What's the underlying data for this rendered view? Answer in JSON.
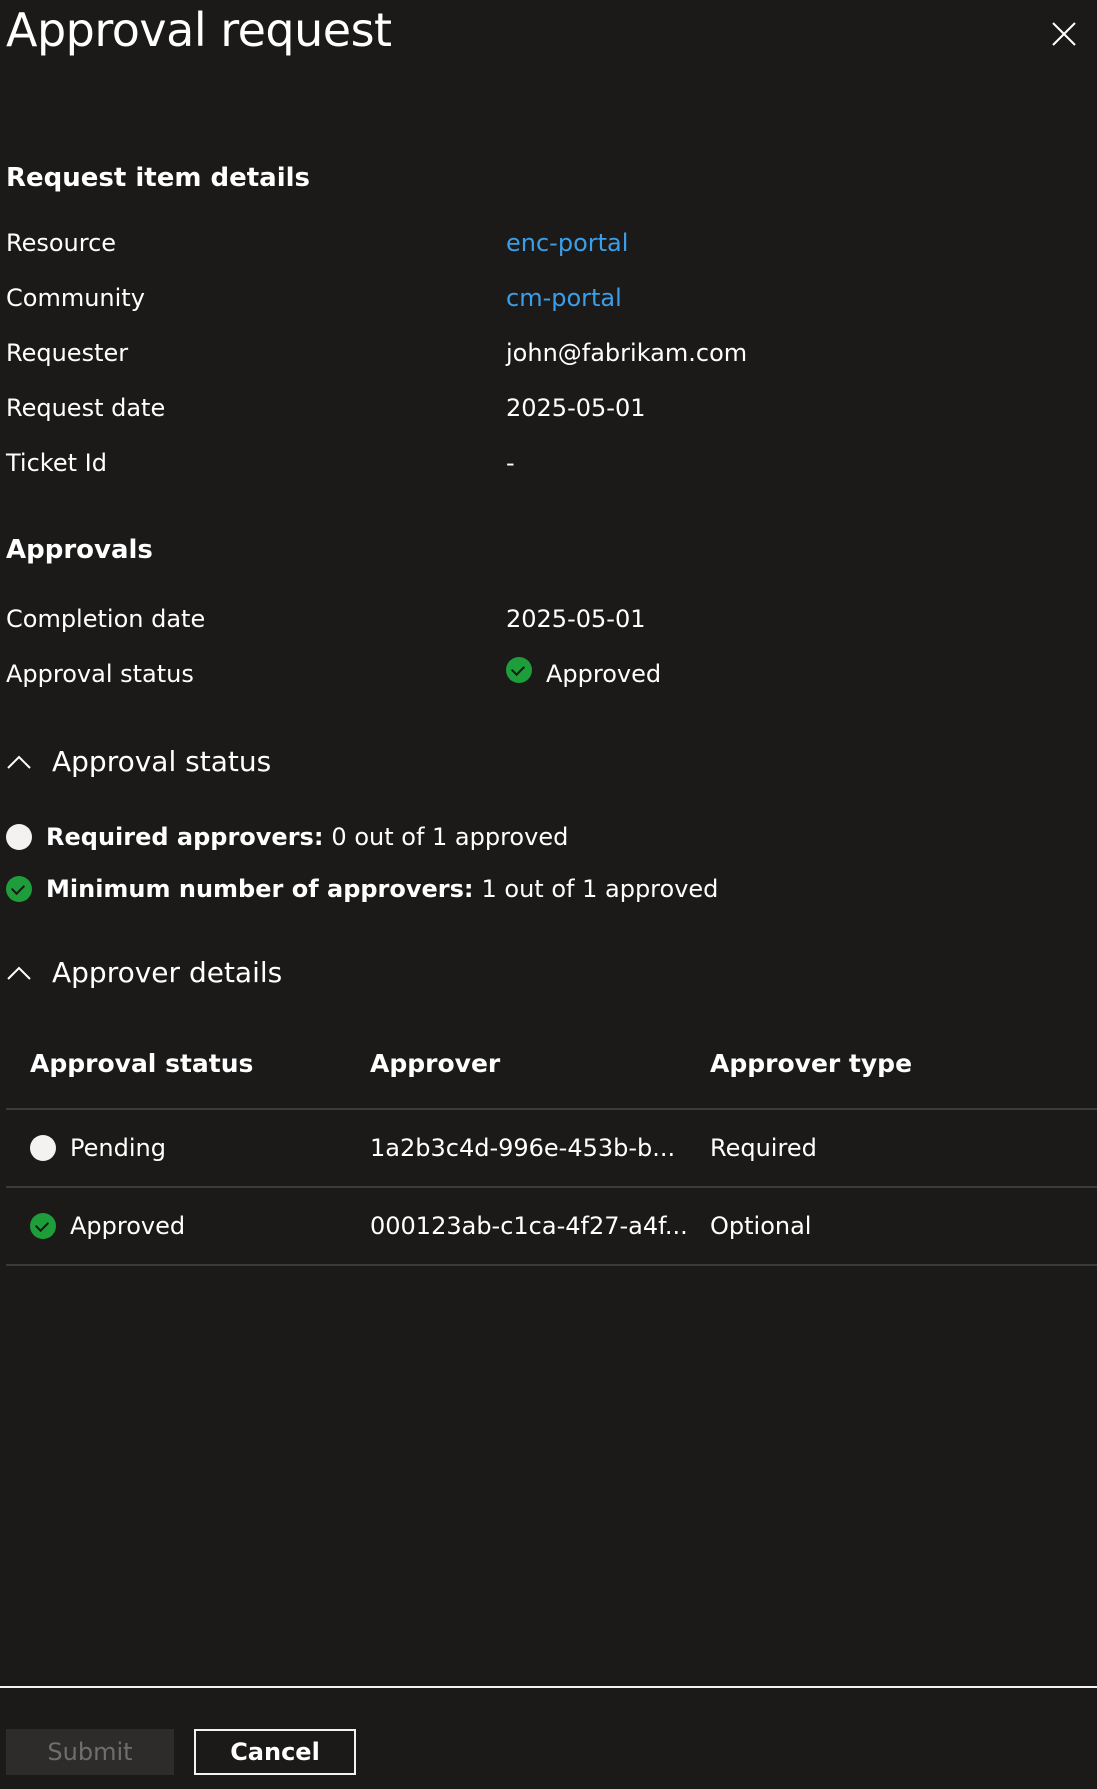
{
  "panel": {
    "title": "Approval request",
    "close_icon": "close-icon"
  },
  "request_details": {
    "heading": "Request item details",
    "rows": [
      {
        "label": "Resource",
        "value": "enc-portal",
        "is_link": true
      },
      {
        "label": "Community",
        "value": "cm-portal",
        "is_link": true
      },
      {
        "label": "Requester",
        "value": "john@fabrikam.com",
        "is_link": false
      },
      {
        "label": "Request date",
        "value": "2025-05-01",
        "is_link": false
      },
      {
        "label": "Ticket Id",
        "value": "-",
        "is_link": false
      }
    ]
  },
  "approvals": {
    "heading": "Approvals",
    "completion_date_label": "Completion date",
    "completion_date": "2025-05-01",
    "status_label": "Approval status",
    "status_value": "Approved",
    "status_icon": "success-check-icon"
  },
  "approval_status_section": {
    "header": "Approval status",
    "expanded": true,
    "criteria": [
      {
        "icon": "pending-circle-icon",
        "label": "Required approvers:",
        "value": "0 out of 1 approved"
      },
      {
        "icon": "success-check-icon",
        "label": "Minimum number of approvers:",
        "value": "1 out of 1 approved"
      }
    ]
  },
  "approver_details_section": {
    "header": "Approver details",
    "expanded": true,
    "columns": [
      "Approval status",
      "Approver",
      "Approver type"
    ],
    "rows": [
      {
        "status": "Pending",
        "status_icon": "pending-circle-icon",
        "approver": "1a2b3c4d-996e-453b-b...",
        "type": "Required"
      },
      {
        "status": "Approved",
        "status_icon": "success-check-icon",
        "approver": "000123ab-c1ca-4f27-a4f...",
        "type": "Optional"
      }
    ]
  },
  "footer": {
    "submit_label": "Submit",
    "submit_disabled": true,
    "cancel_label": "Cancel"
  },
  "colors": {
    "background": "#1b1a19",
    "link": "#3b9ee8",
    "success": "#1e9e3a",
    "pending": "#f3f2f1",
    "divider": "#3b3a39"
  }
}
